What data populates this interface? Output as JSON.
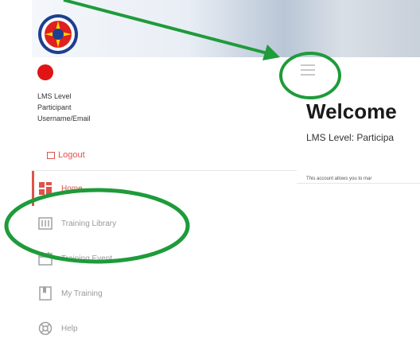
{
  "user": {
    "lms_level_label": "LMS Level",
    "lms_level_value": "Participant",
    "username_label": "Username/Email"
  },
  "sidebar": {
    "logout_label": "Logout",
    "items": [
      {
        "label": "Home",
        "icon": "home-icon",
        "active": true
      },
      {
        "label": "Training Library",
        "icon": "library-icon",
        "active": false
      },
      {
        "label": "Training Event",
        "icon": "calendar-icon",
        "active": false
      },
      {
        "label": "My Training",
        "icon": "bookmark-icon",
        "active": false
      },
      {
        "label": "Help",
        "icon": "help-icon",
        "active": false
      }
    ]
  },
  "main": {
    "welcome_title": "Welcome",
    "lms_level_line": "LMS Level: Participa",
    "account_note": "This account allows you to mar"
  },
  "colors": {
    "accent": "#e0524a",
    "status_dot": "#e01414",
    "annotation_green": "#1e9b3a"
  }
}
